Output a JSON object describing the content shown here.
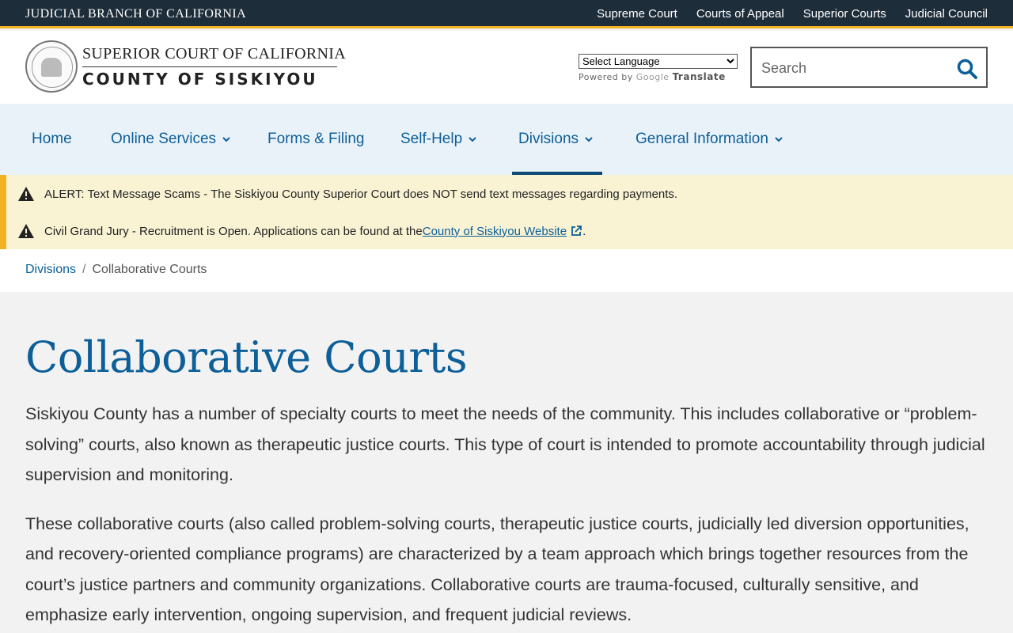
{
  "topbar": {
    "brand": "JUDICIAL BRANCH OF CALIFORNIA",
    "links": [
      "Supreme Court",
      "Courts of Appeal",
      "Superior Courts",
      "Judicial Council"
    ]
  },
  "header": {
    "title_line1": "SUPERIOR COURT OF CALIFORNIA",
    "title_line2": "COUNTY OF SISKIYOU",
    "language_select": "Select Language",
    "powered_by": "Powered by",
    "google": "Google",
    "translate": "Translate",
    "search_placeholder": "Search"
  },
  "nav": {
    "items": [
      {
        "label": "Home",
        "dropdown": false
      },
      {
        "label": "Online Services",
        "dropdown": true
      },
      {
        "label": "Forms & Filing",
        "dropdown": false
      },
      {
        "label": "Self-Help",
        "dropdown": true
      },
      {
        "label": "Divisions",
        "dropdown": true,
        "active": true
      },
      {
        "label": "General Information",
        "dropdown": true
      }
    ]
  },
  "alerts": [
    {
      "text": "ALERT: Text Message Scams - The Siskiyou County Superior Court does NOT send text messages regarding payments."
    },
    {
      "text": "Civil Grand Jury - Recruitment is Open.  Applications can be found at the ",
      "link": "County of Siskiyou Website",
      "after": "."
    }
  ],
  "breadcrumb": {
    "parent": "Divisions",
    "separator": "/",
    "current": "Collaborative Courts"
  },
  "main": {
    "title": "Collaborative Courts",
    "paragraphs": [
      "Siskiyou County has a number of specialty courts to meet the needs of the community. This includes collaborative or “problem-solving” courts, also known as therapeutic justice courts. This type of court is intended to promote accountability through judicial supervision and monitoring.",
      "These collaborative courts (also called problem-solving courts, therapeutic justice courts, judicially led diversion opportunities, and recovery-oriented compliance programs) are characterized by a team approach which brings together resources from the court’s justice partners and community organizations. Collaborative courts are trauma-focused, culturally sensitive, and emphasize early intervention, ongoing supervision, and frequent judicial reviews."
    ]
  },
  "colors": {
    "topbar": "#1d2d3a",
    "accent_gold": "#f0b323",
    "link_blue": "#0c5f99",
    "nav_bg": "#eaf2f9",
    "alert_bg": "#f9f3d4"
  }
}
